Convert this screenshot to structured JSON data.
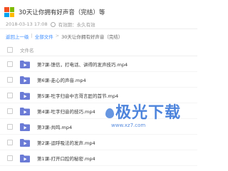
{
  "header": {
    "title": "30天让你拥有好声音（完结）等"
  },
  "meta": {
    "date": "2018-03-13 17:08",
    "validity_label": "有效期：永久有效"
  },
  "breadcrumb": {
    "back": "返回上一级",
    "all": "全部文件",
    "current": "30天让你拥有好声音（完结）"
  },
  "list_header": {
    "column": "文件名"
  },
  "files": [
    "第7课-馈信，打电话、讲得的发声技巧.mp4",
    "第6课-走心的声音.mp4",
    "第5课-吐字归音中言哥言匠的首节.mp4",
    "第4课-吐字归音的技巧.mp4",
    "第3课-共鸣.mp4",
    "第2课-运呼吸法的发声.mp4",
    "第1课-打开口腔的秘密.mp4"
  ],
  "watermark": {
    "text": "极光下载",
    "url": "www.xz7.com"
  },
  "colors": {
    "folder_icon": "#6b7bd6",
    "link": "#3b8cff",
    "watermark": "#2e6fd6"
  }
}
